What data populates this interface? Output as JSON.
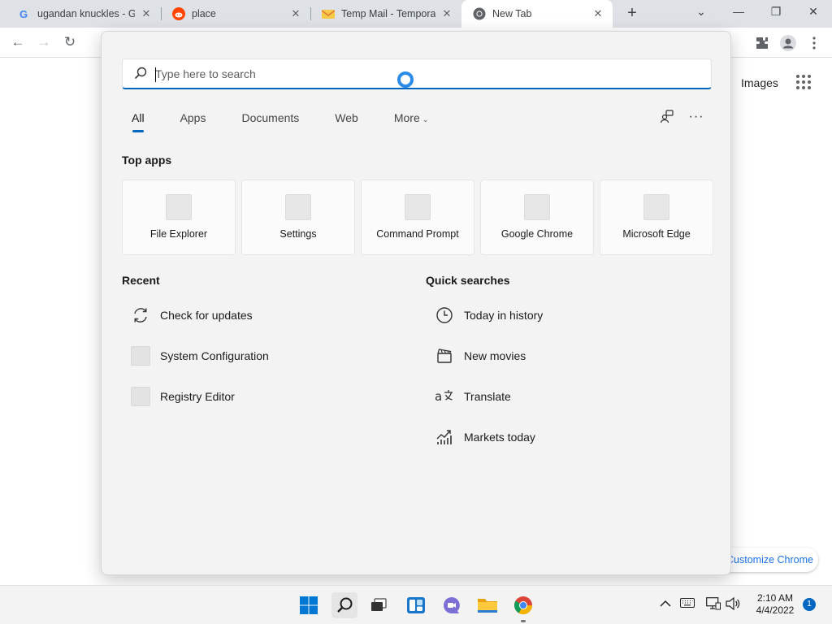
{
  "browser": {
    "tabs": [
      {
        "title": "ugandan knuckles - Go",
        "favicon": "google-g-icon",
        "active": false
      },
      {
        "title": "place",
        "favicon": "reddit-icon",
        "active": false
      },
      {
        "title": "Temp Mail - Temporary",
        "favicon": "temp-mail-icon",
        "active": false
      },
      {
        "title": "New Tab",
        "favicon": "chrome-icon",
        "active": true
      }
    ],
    "new_tab_symbol": "+",
    "close_symbol": "✕",
    "window_controls": {
      "dropdown": "⌄",
      "minimize": "—",
      "restore": "❐",
      "close": "✕"
    },
    "toolbar": {
      "back": "←",
      "forward": "→",
      "reload": "↻"
    },
    "ntp": {
      "images_link": "Images",
      "customize_label": "Customize Chrome"
    }
  },
  "search": {
    "placeholder": "Type here to search",
    "filters": [
      "All",
      "Apps",
      "Documents",
      "Web",
      "More"
    ],
    "active_filter": "All",
    "more_chevron": "⌄",
    "more_options": "···",
    "top_apps_heading": "Top apps",
    "top_apps": [
      "File Explorer",
      "Settings",
      "Command Prompt",
      "Google Chrome",
      "Microsoft Edge"
    ],
    "recent_heading": "Recent",
    "recent": [
      {
        "label": "Check for updates",
        "icon": "sync-icon"
      },
      {
        "label": "System Configuration",
        "icon": "placeholder-icon"
      },
      {
        "label": "Registry Editor",
        "icon": "placeholder-icon"
      }
    ],
    "quick_heading": "Quick searches",
    "quick": [
      {
        "label": "Today in history",
        "icon": "clock-icon"
      },
      {
        "label": "New movies",
        "icon": "clapperboard-icon"
      },
      {
        "label": "Translate",
        "icon": "translate-icon"
      },
      {
        "label": "Markets today",
        "icon": "chart-icon"
      }
    ]
  },
  "taskbar": {
    "time": "2:10 AM",
    "date": "4/4/2022",
    "notifications": "1"
  },
  "colors": {
    "accent": "#0067c0",
    "chrome_tab_strip": "#dee1e6"
  }
}
